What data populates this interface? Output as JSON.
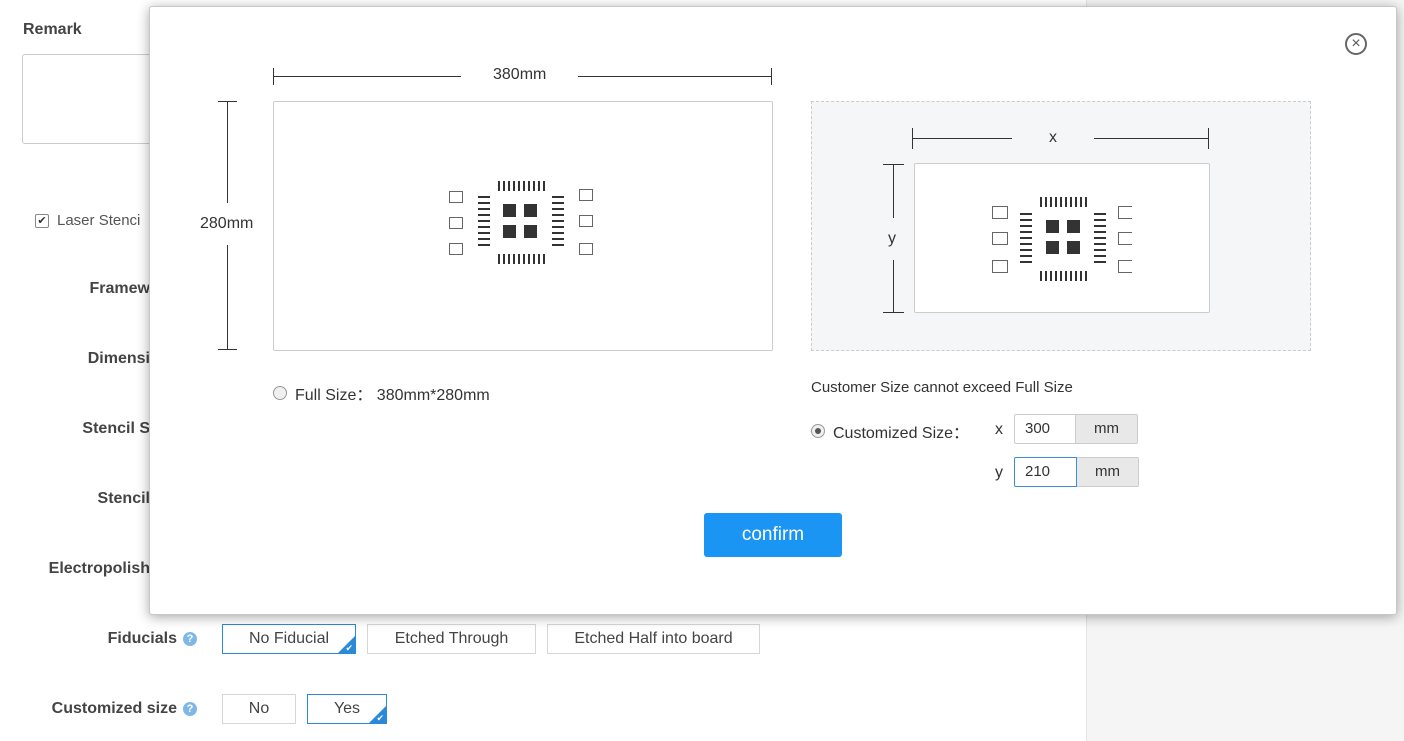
{
  "background": {
    "remark_label": "Remark",
    "laser_label": "Laser Stenci",
    "rows": [
      {
        "label": "Framew"
      },
      {
        "label": "Dimensi"
      },
      {
        "label": "Stencil S"
      },
      {
        "label": "Stencil"
      },
      {
        "label": "Electropolish"
      }
    ],
    "fiducials": {
      "label": "Fiducials",
      "options": [
        "No Fiducial",
        "Etched Through",
        "Etched Half into board"
      ],
      "selected": "No Fiducial"
    },
    "customized_size": {
      "label": "Customized size",
      "options": [
        "No",
        "Yes"
      ],
      "selected": "Yes"
    }
  },
  "modal": {
    "close_icon": "close-circle-icon",
    "full": {
      "width_label": "380mm",
      "height_label": "280mm",
      "radio_label": "Full Size： 380mm*280mm",
      "selected": false
    },
    "custom": {
      "x_label": "x",
      "y_label": "y",
      "note": "Customer Size cannot exceed Full Size",
      "radio_label": "Customized Size：",
      "selected": true,
      "x_axis": "x",
      "y_axis": "y",
      "x_value": "300",
      "y_value": "210",
      "unit": "mm"
    },
    "confirm_label": "confirm"
  },
  "colors": {
    "accent": "#1a95f3",
    "selected_border": "#2a8ad8",
    "help_icon": "#7fb8e6"
  }
}
